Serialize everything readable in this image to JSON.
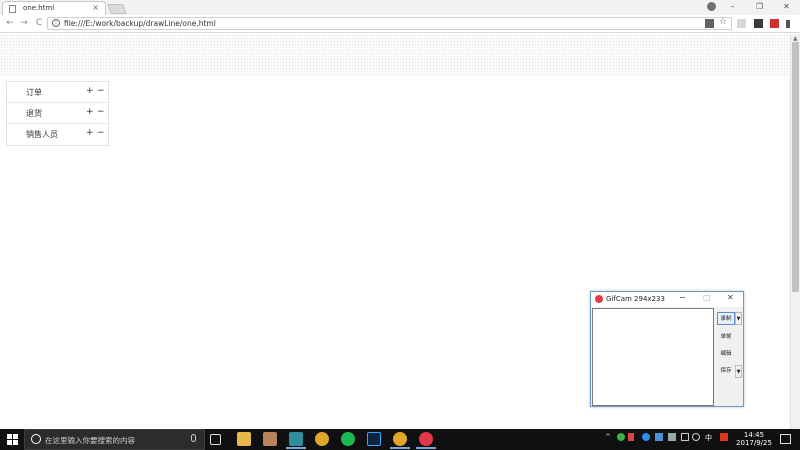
{
  "browser": {
    "tab_title": "one.html",
    "tab_close": "×",
    "url": "file:///E:/work/backup/drawLine/one.html",
    "nav": {
      "back": "←",
      "forward": "→",
      "reload": "C"
    },
    "info_glyph": "i",
    "star_glyph": "☆",
    "window_controls": {
      "minimize": "–",
      "maximize": "❐",
      "close": "✕"
    }
  },
  "menu": {
    "items": [
      {
        "label": "订单",
        "plus": "+",
        "minus": "−"
      },
      {
        "label": "退货",
        "plus": "+",
        "minus": "−"
      },
      {
        "label": "销售人员",
        "plus": "+",
        "minus": "−"
      }
    ]
  },
  "gifcam": {
    "title": "GifCam 294x233",
    "minimize": "−",
    "maximize": "□",
    "close": "✕",
    "buttons": {
      "record": "录制",
      "frame": "单帧",
      "edit": "编辑",
      "save": "保存"
    },
    "dropdown": "▼"
  },
  "taskbar": {
    "search_placeholder": "在这里输入你要搜索的内容",
    "ime": "中",
    "time": "14:45",
    "date": "2017/9/25",
    "tray_up": "^"
  },
  "colors": {
    "accent": "#5c8fc7",
    "taskbar": "#101010",
    "gifcam_logo": "#e2384a"
  }
}
